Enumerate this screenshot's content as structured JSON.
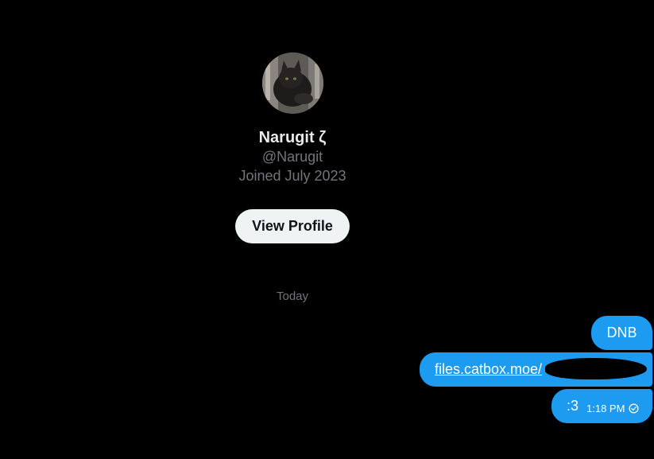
{
  "profile": {
    "display_name": "Narugit ζ",
    "handle": "@Narugit",
    "joined": "Joined July 2023",
    "view_profile_label": "View Profile"
  },
  "conversation": {
    "date_separator": "Today",
    "messages": [
      {
        "text": "DNB",
        "sent_by_me": true
      },
      {
        "text": "files.catbox.moe/",
        "type": "link",
        "sent_by_me": true,
        "redacted": true
      },
      {
        "text": ":3",
        "time": "1:18 PM",
        "status": "seen-check-icon",
        "sent_by_me": true
      }
    ]
  },
  "colors": {
    "background": "#000000",
    "bubble": "#1d9bf0",
    "primary_text": "#e7e9ea",
    "secondary_text": "#71767b",
    "button_bg": "#eff3f4"
  }
}
